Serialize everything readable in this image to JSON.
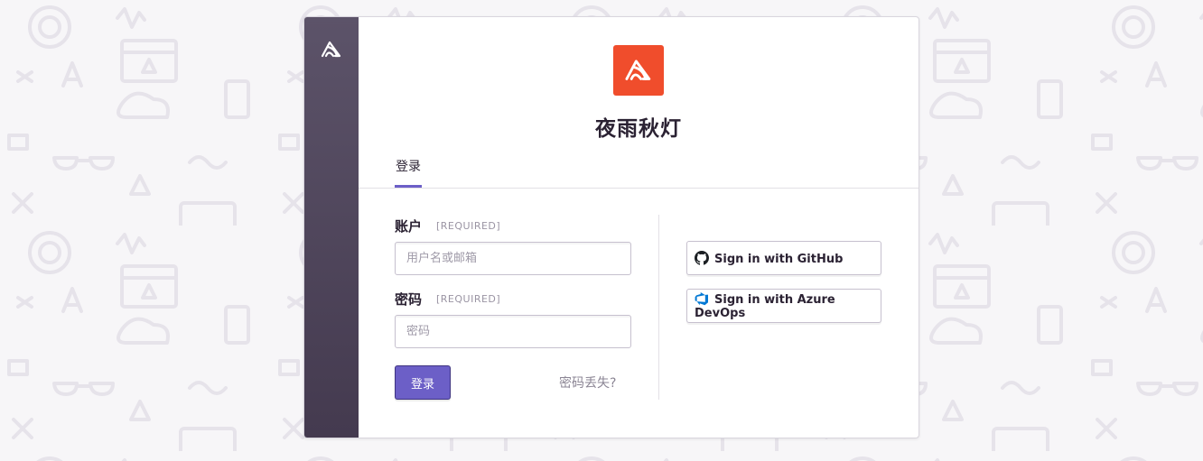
{
  "colors": {
    "accent": "#6c5fc7",
    "brand_logo": "#f04d2c",
    "sidebar": "#4e4459",
    "background": "#f7f6f8"
  },
  "icons": {
    "sidebar_logo": "sentry-logo-icon",
    "org_logo": "sentry-logo-icon",
    "github": "github-icon",
    "azure": "azure-devops-icon"
  },
  "org": {
    "name": "夜雨秋灯"
  },
  "tabs": [
    {
      "label": "登录"
    }
  ],
  "form": {
    "account": {
      "label": "账户",
      "required": "[REQUIRED]",
      "placeholder": "用户名或邮箱",
      "value": ""
    },
    "password": {
      "label": "密码",
      "required": "[REQUIRED]",
      "placeholder": "密码",
      "value": ""
    },
    "submit_label": "登录",
    "lost_password_label": "密码丢失?"
  },
  "sso": {
    "github_label": "Sign in with GitHub",
    "azure_label": "Sign in with Azure DevOps"
  }
}
